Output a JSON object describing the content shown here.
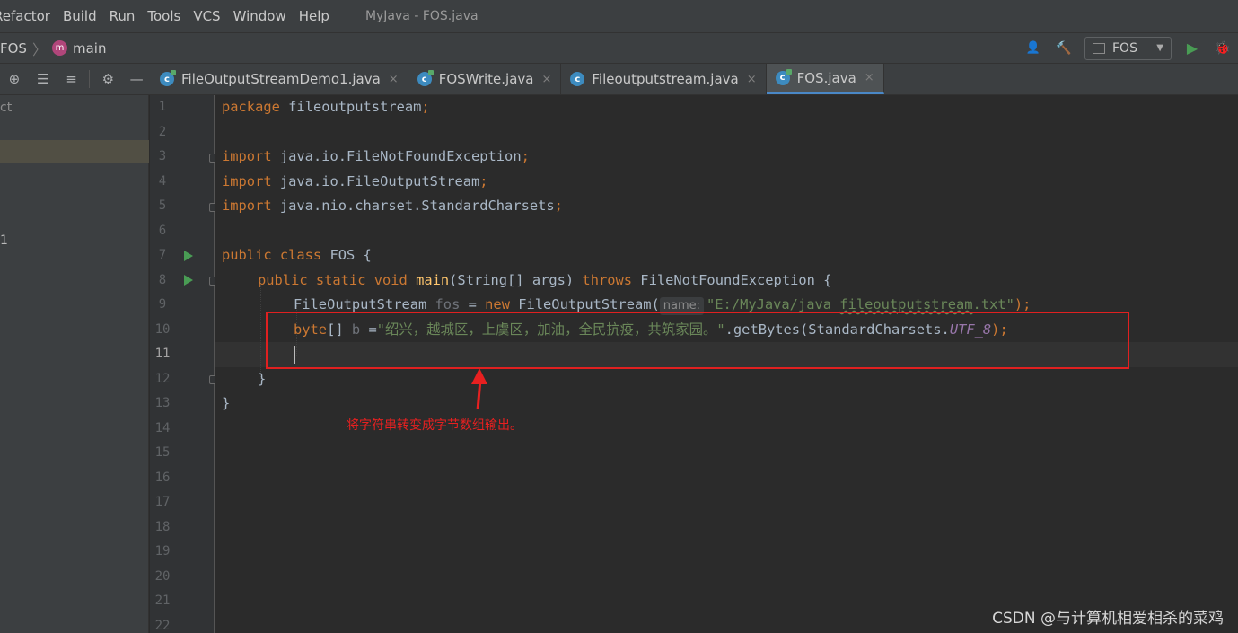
{
  "menu": {
    "items": [
      "Refactor",
      "Build",
      "Run",
      "Tools",
      "VCS",
      "Window",
      "Help"
    ],
    "window_title": "MyJava - FOS.java"
  },
  "nav": {
    "project": "FOS",
    "method": "main",
    "run_config": "FOS",
    "module_icon": "m"
  },
  "tabs": [
    {
      "label": "FileOutputStreamDemo1.java",
      "active": false,
      "main": true
    },
    {
      "label": "FOSWrite.java",
      "active": false,
      "main": true
    },
    {
      "label": "Fileoutputstream.java",
      "active": false,
      "main": false
    },
    {
      "label": "FOS.java",
      "active": true,
      "main": true
    }
  ],
  "tab_class_glyph": "c",
  "tab_close": "×",
  "sidebar": {
    "label": "ct",
    "number": "1"
  },
  "editor": {
    "line_numbers": [
      "1",
      "2",
      "3",
      "4",
      "5",
      "6",
      "7",
      "8",
      "9",
      "10",
      "11",
      "12",
      "13",
      "14",
      "15",
      "16",
      "17",
      "18",
      "19",
      "20",
      "21",
      "22"
    ],
    "current_line": 11,
    "code": {
      "l1_kw": "package",
      "l1_rest": " fileoutputstream",
      "semicolon": ";",
      "import_kw": "import",
      "l3_rest": " java.io.FileNotFoundException",
      "l4_rest": " java.io.FileOutputStream",
      "l5_rest": " java.nio.charset.StandardCharsets",
      "l7_kw": "public class",
      "l7_rest": " FOS {",
      "l8_kw1": "public static void",
      "l8_fn": "main",
      "l8_mid": "(String[] args) ",
      "l8_kw2": "throws",
      "l8_rest": " FileNotFoundException {",
      "l9_type": "FileOutputStream ",
      "l9_var": "fos",
      "l9_eq": " = ",
      "l9_new": "new",
      "l9_ctor": " FileOutputStream(",
      "l9_hint": "name:",
      "l9_str_a": "\"E:/MyJava/java ",
      "l9_str_b": "fileoutputstream",
      "l9_str_c": ".txt\"",
      "l9_end": ");",
      "l10_kw": "byte",
      "l10_arr": "[] ",
      "l10_var": "b",
      "l10_eq": " =",
      "l10_str": "\"绍兴，越城区，上虞区，加油，全民抗疫，共筑家园。\"",
      "l10_call": ".getBytes(StandardCharsets.",
      "l10_const": "UTF_8",
      "l10_end": ");",
      "l12": "}",
      "l13": "}"
    }
  },
  "annotation": {
    "text": "将字符串转变成字节数组输出。",
    "color": "#e82020"
  },
  "watermark": "CSDN @与计算机相爱相杀的菜鸡",
  "icons": {
    "user": "👤",
    "hammer": "🔨",
    "run": "▶",
    "debug": "🐞",
    "target": "⊕",
    "expand": "☰",
    "collapse": "≡",
    "gear": "⚙",
    "minimize": "—",
    "chevron": "〉",
    "dropdown": "▼"
  }
}
